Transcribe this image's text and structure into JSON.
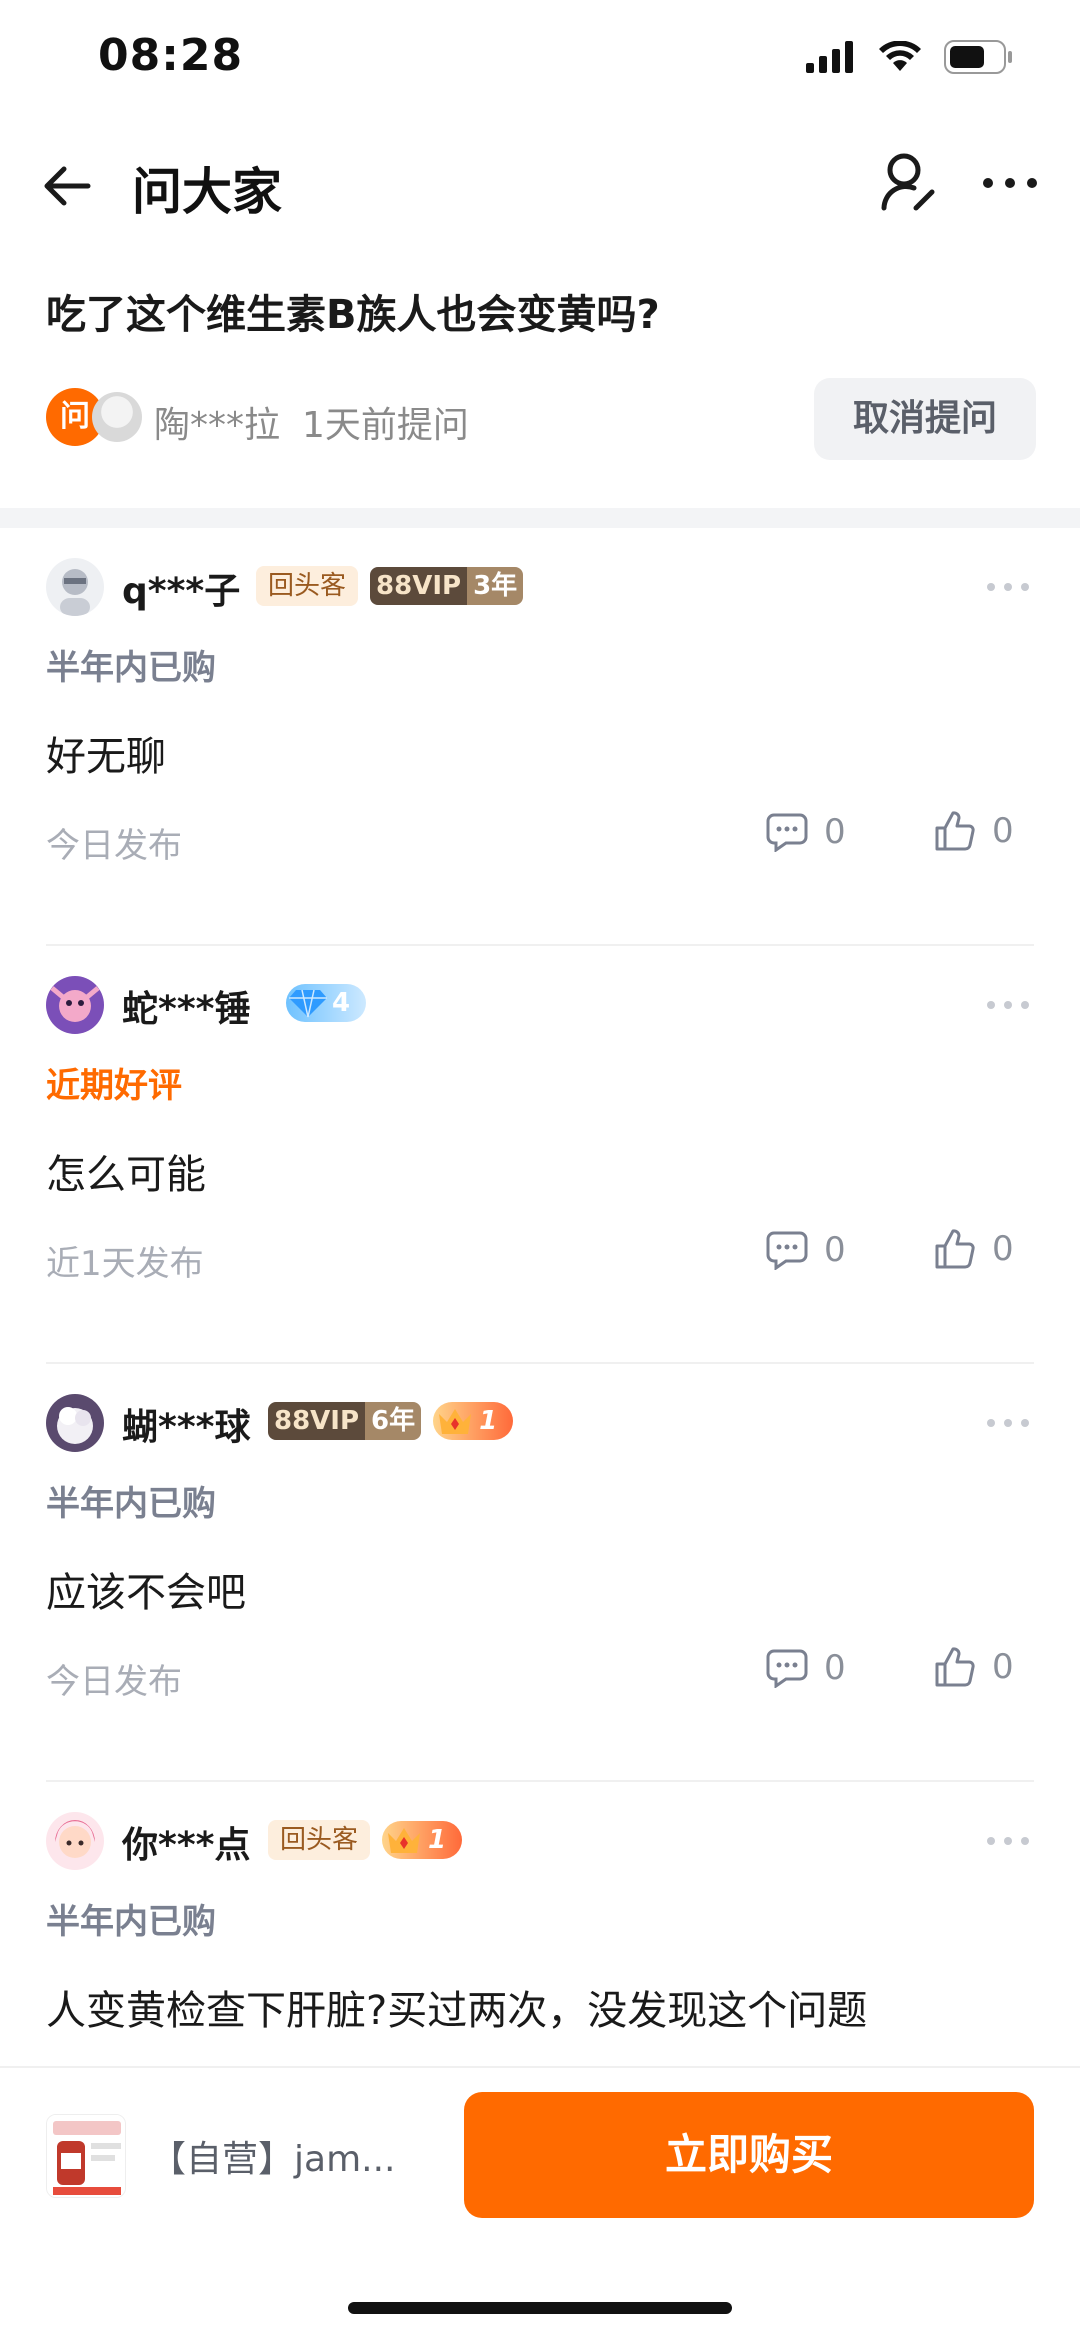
{
  "status_bar": {
    "time": "08:28"
  },
  "nav": {
    "title": "问大家",
    "icons": [
      "back-arrow-icon",
      "profile-edit-icon",
      "more-horizontal-icon"
    ]
  },
  "question": {
    "text": "吃了这个维生素B族人也会变黄吗?",
    "badge": "问",
    "asker": "陶***拉",
    "time": "1天前提问",
    "cancel_label": "取消提问"
  },
  "answers": [
    {
      "user": "q***子",
      "badges": {
        "return": "回头客",
        "vip": "88VIP",
        "vip_years": "3年"
      },
      "tag": "半年内已购",
      "text": "好无聊",
      "time": "今日发布",
      "comments": "0",
      "likes": "0"
    },
    {
      "user": "蛇***锤",
      "badges": {
        "diamond_level": "4"
      },
      "tag": "近期好评",
      "text": "怎么可能",
      "time": "近1天发布",
      "comments": "0",
      "likes": "0"
    },
    {
      "user": "蝴***球",
      "badges": {
        "vip": "88VIP",
        "vip_years": "6年",
        "crown_level": "1"
      },
      "tag": "半年内已购",
      "text": "应该不会吧",
      "time": "今日发布",
      "comments": "0",
      "likes": "0"
    },
    {
      "user": "你***点",
      "badges": {
        "return": "回头客",
        "crown_level": "1"
      },
      "tag": "半年内已购",
      "text": "人变黄检查下肝脏?买过两次，没发现这个问题"
    }
  ],
  "bottom_bar": {
    "product_name": "【自营】jam...",
    "buy_label": "立即购买"
  },
  "colors": {
    "accent": "#ff6a00",
    "muted": "#a9adb6",
    "tag": "#7a8090"
  }
}
